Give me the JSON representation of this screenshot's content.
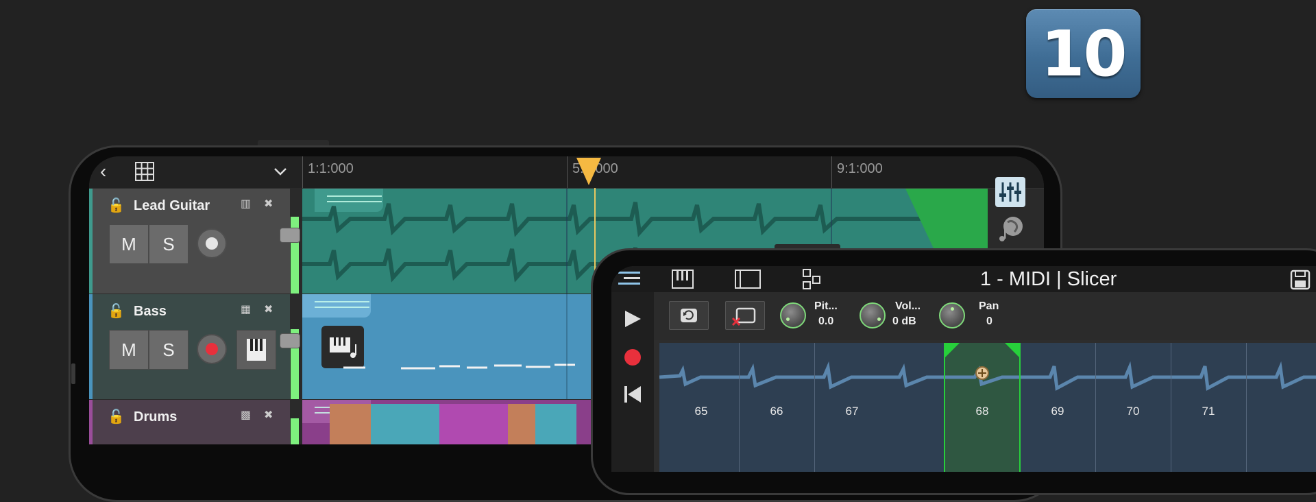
{
  "badge": {
    "version": "10"
  },
  "ruler": {
    "markers": [
      "1:1:000",
      "5:1:000",
      "9:1:000"
    ]
  },
  "tracks": [
    {
      "name": "Lead Guitar",
      "mute": "M",
      "solo": "S"
    },
    {
      "name": "Bass",
      "mute": "M",
      "solo": "S"
    },
    {
      "name": "Drums"
    }
  ],
  "slicer": {
    "title": "1 - MIDI | Slicer",
    "pitch_label": "Pit...",
    "pitch_value": "0.0",
    "volume_label": "Vol...",
    "volume_value": "0 dB",
    "pan_label": "Pan",
    "pan_value": "0",
    "slices": [
      "65",
      "66",
      "67",
      "68",
      "69",
      "70",
      "71"
    ]
  },
  "colors": {
    "lead_clip": "#2f8577",
    "bass_clip": "#4a94bd",
    "meter": "#7ef07e",
    "record": "#e8303c",
    "playhead": "#f5b942",
    "badge": "#4a7aa3"
  }
}
